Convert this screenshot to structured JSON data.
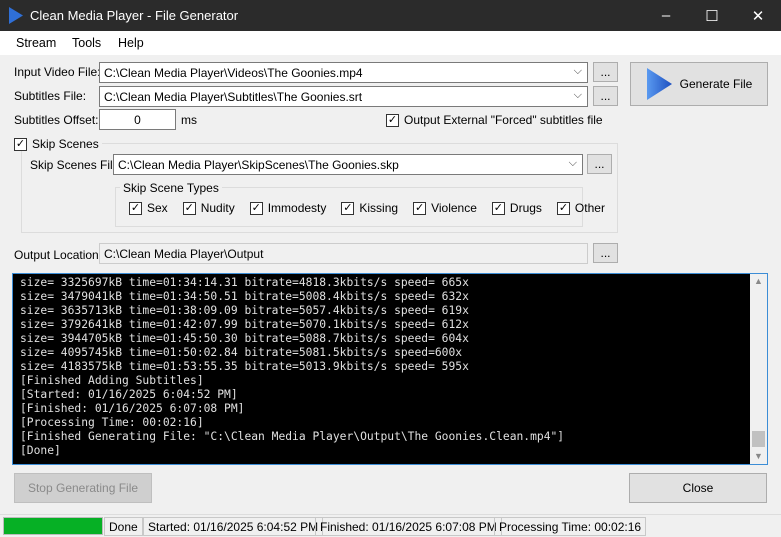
{
  "window": {
    "title": "Clean Media Player - File Generator",
    "minimize": "–",
    "maximize": "☐",
    "close": "✕"
  },
  "menu": [
    "Stream",
    "Tools",
    "Help"
  ],
  "form": {
    "input_video_label": "Input Video File:",
    "input_video_value": "C:\\Clean Media Player\\Videos\\The Goonies.mp4",
    "subtitles_label": "Subtitles File:",
    "subtitles_value": "C:\\Clean Media Player\\Subtitles\\The Goonies.srt",
    "offset_label": "Subtitles Offset:",
    "offset_value": "0",
    "offset_unit": "ms",
    "forced_label": "Output External \"Forced\" subtitles file",
    "forced_checked": true,
    "browse": "...",
    "generate": "Generate File",
    "skip_scenes_label": "Skip Scenes",
    "skip_scenes_checked": true,
    "skip_file_label": "Skip Scenes File:",
    "skip_file_value": "C:\\Clean Media Player\\SkipScenes\\The Goonies.skp",
    "skip_types_label": "Skip Scene Types",
    "skip_types": [
      "Sex",
      "Nudity",
      "Immodesty",
      "Kissing",
      "Violence",
      "Drugs",
      "Other"
    ],
    "output_label": "Output Location:",
    "output_value": "C:\\Clean Media Player\\Output"
  },
  "console_lines": [
    "size= 3325697kB time=01:34:14.31 bitrate=4818.3kbits/s speed= 665x",
    "size= 3479041kB time=01:34:50.51 bitrate=5008.4kbits/s speed= 632x",
    "size= 3635713kB time=01:38:09.09 bitrate=5057.4kbits/s speed= 619x",
    "size= 3792641kB time=01:42:07.99 bitrate=5070.1kbits/s speed= 612x",
    "size= 3944705kB time=01:45:50.30 bitrate=5088.7kbits/s speed= 604x",
    "size= 4095745kB time=01:50:02.84 bitrate=5081.5kbits/s speed=600x",
    "size= 4183575kB time=01:53:55.35 bitrate=5013.9kbits/s speed= 595x",
    "[Finished Adding Subtitles]",
    "[Started: 01/16/2025 6:04:52 PM]",
    "[Finished: 01/16/2025 6:07:08 PM]",
    "[Processing Time: 00:02:16]",
    "[Finished Generating File: \"C:\\Clean Media Player\\Output\\The Goonies.Clean.mp4\"]",
    "[Done]"
  ],
  "buttons": {
    "stop": "Stop Generating File",
    "close": "Close"
  },
  "status": {
    "progress": 100,
    "state": "Done",
    "started": "Started: 01/16/2025 6:04:52 PM",
    "finished": "Finished: 01/16/2025 6:07:08 PM",
    "processing": "Processing Time: 00:02:16"
  },
  "colors": {
    "accent": "#2f6fd6",
    "progress": "#06b025"
  }
}
